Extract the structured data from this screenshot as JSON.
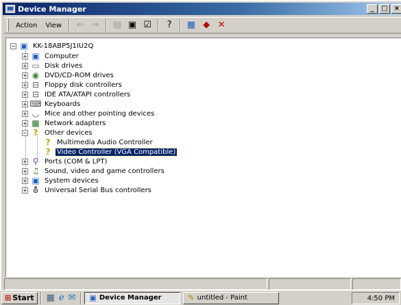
{
  "window": {
    "title": "Device Manager"
  },
  "menu": {
    "action": "Action",
    "view": "View"
  },
  "toolbar_icons": [
    "back-arrow-icon",
    "forward-arrow-icon",
    "up-folder-icon",
    "show-hide-tree-icon",
    "properties-icon",
    "help-icon",
    "scan-hardware-icon",
    "update-driver-icon",
    "uninstall-icon"
  ],
  "tree": {
    "root": "KK-18ABP5J1IU2Q",
    "items": [
      {
        "label": "Computer",
        "icon": "computer-icon"
      },
      {
        "label": "Disk drives",
        "icon": "disk-drive-icon"
      },
      {
        "label": "DVD/CD-ROM drives",
        "icon": "cdrom-icon"
      },
      {
        "label": "Floppy disk controllers",
        "icon": "floppy-controller-icon"
      },
      {
        "label": "IDE ATA/ATAPI controllers",
        "icon": "ide-controller-icon"
      },
      {
        "label": "Keyboards",
        "icon": "keyboard-icon"
      },
      {
        "label": "Mice and other pointing devices",
        "icon": "mouse-icon"
      },
      {
        "label": "Network adapters",
        "icon": "network-adapter-icon"
      },
      {
        "label": "Other devices",
        "icon": "unknown-device-icon",
        "children": [
          {
            "label": "Multimedia Audio Controller",
            "icon": "unknown-device-icon"
          },
          {
            "label": "Video Controller (VGA Compatible)",
            "icon": "unknown-device-icon",
            "selected": true
          }
        ]
      },
      {
        "label": "Ports (COM & LPT)",
        "icon": "port-icon"
      },
      {
        "label": "Sound, video and game controllers",
        "icon": "sound-icon"
      },
      {
        "label": "System devices",
        "icon": "system-device-icon"
      },
      {
        "label": "Universal Serial Bus controllers",
        "icon": "usb-icon"
      }
    ]
  },
  "taskbar": {
    "start": "Start",
    "tasks": [
      {
        "label": "Device Manager",
        "active": true
      },
      {
        "label": "untitled - Paint",
        "active": false
      }
    ],
    "clock": "4:50 PM"
  },
  "colors": {
    "title_gradient_start": "#0a246a",
    "selection": "#0a246a",
    "face": "#d4d0c8"
  }
}
